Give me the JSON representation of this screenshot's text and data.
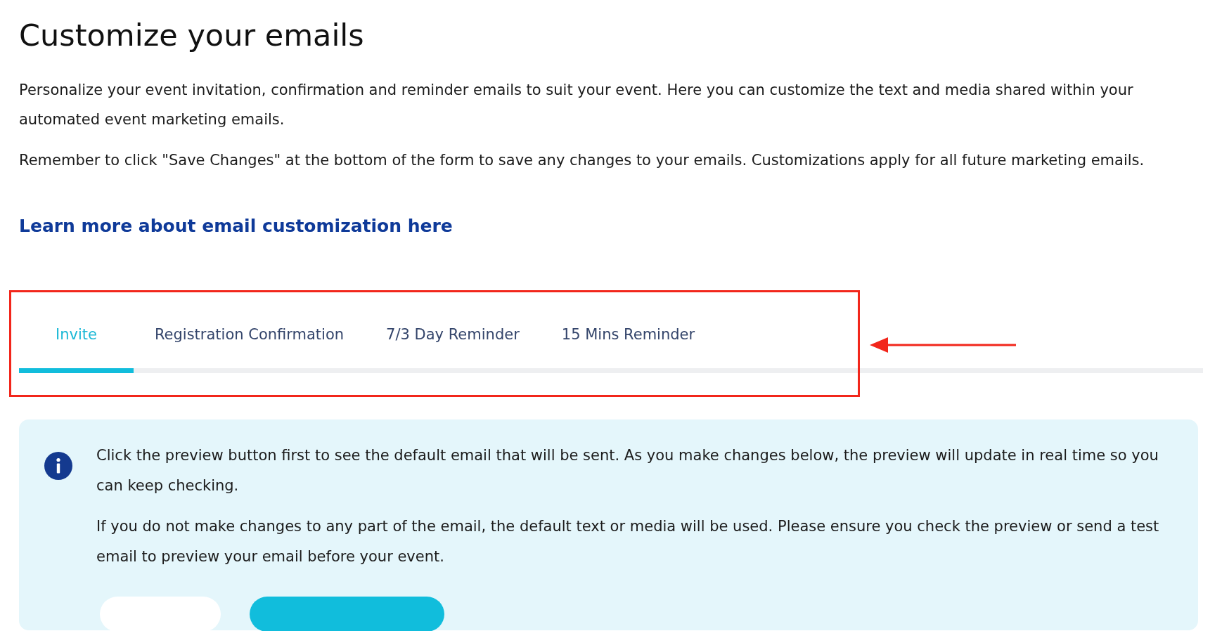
{
  "heading": "Customize your emails",
  "intro": [
    "Personalize your event invitation, confirmation and reminder emails to suit your event. Here you can customize the text and media shared within your automated event marketing emails.",
    "Remember to click \"Save Changes\" at the bottom of the form to save any changes to your emails. Customizations apply for all future marketing emails."
  ],
  "link": "Learn more about email customization here",
  "tabs": [
    {
      "label": "Invite",
      "selected": true
    },
    {
      "label": "Registration Confirmation",
      "selected": false
    },
    {
      "label": "7/3 Day Reminder",
      "selected": false
    },
    {
      "label": "15 Mins Reminder",
      "selected": false
    }
  ],
  "info": {
    "paragraphs": [
      "Click the preview button first to see the default email that will be sent. As you make changes below, the preview will update in real time so you can keep checking.",
      "If you do not make changes to any part of the email, the default text or media will be used. Please ensure you check the preview or send a test email to preview your email before your event."
    ],
    "buttons": [
      {
        "kind": "secondary"
      },
      {
        "kind": "primary"
      }
    ]
  }
}
